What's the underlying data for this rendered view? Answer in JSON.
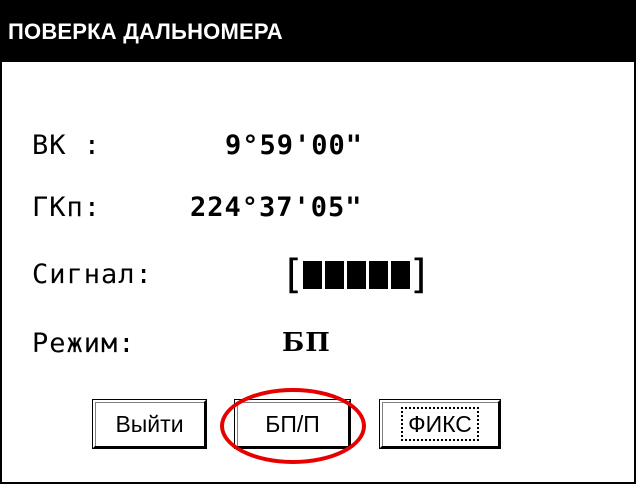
{
  "window": {
    "title": "ПОВЕРКА ДАЛЬНОМЕРА"
  },
  "fields": {
    "vk_label": "ВК :",
    "vk_value": "9°59'00\"",
    "gk_label": "ГКп:",
    "gk_value": "224°37'05\"",
    "signal_label": "Сигнал:",
    "signal_open": "[",
    "signal_close": "]",
    "signal_bars": 5,
    "signal_level_fraction": 1.0,
    "mode_label": "Режим:",
    "mode_value": "БП"
  },
  "buttons": {
    "exit": "Выйти",
    "bp_p": "БП/П",
    "fix": "ФИКС"
  },
  "annotation": {
    "highlight_color": "#e60000",
    "highlight_target": "bp-p-button"
  }
}
